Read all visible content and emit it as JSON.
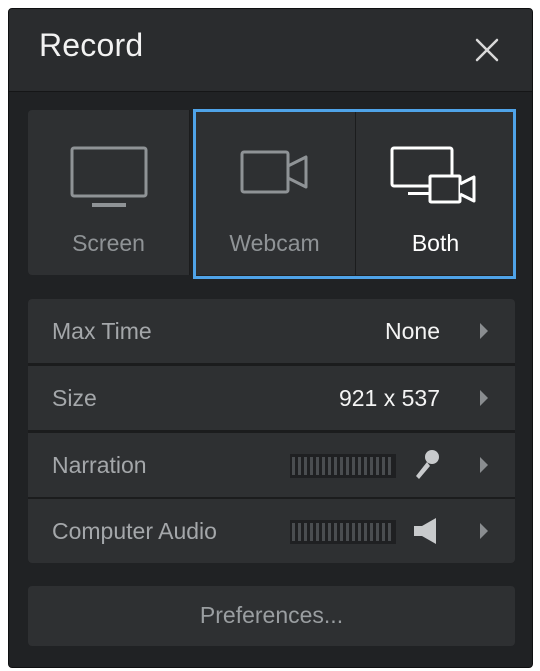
{
  "window": {
    "title": "Record"
  },
  "modes": [
    {
      "label": "Screen",
      "icon": "monitor-icon",
      "selected": false
    },
    {
      "label": "Webcam",
      "icon": "video-camera-icon",
      "selected": true
    },
    {
      "label": "Both",
      "icon": "monitor-with-camera-icon",
      "selected": true
    }
  ],
  "settings": {
    "max_time": {
      "label": "Max Time",
      "value": "None"
    },
    "size": {
      "label": "Size",
      "value": "921 x 537"
    },
    "narration": {
      "label": "Narration",
      "icon": "microphone-icon"
    },
    "computer_audio": {
      "label": "Computer Audio",
      "icon": "speaker-icon"
    }
  },
  "preferences": {
    "label": "Preferences..."
  },
  "colors": {
    "panel_bg": "#202224",
    "row_bg": "#2e3032",
    "selection_border": "#4fa3e8",
    "text_primary": "#f4f4f4",
    "text_secondary": "#a4a7aa"
  }
}
